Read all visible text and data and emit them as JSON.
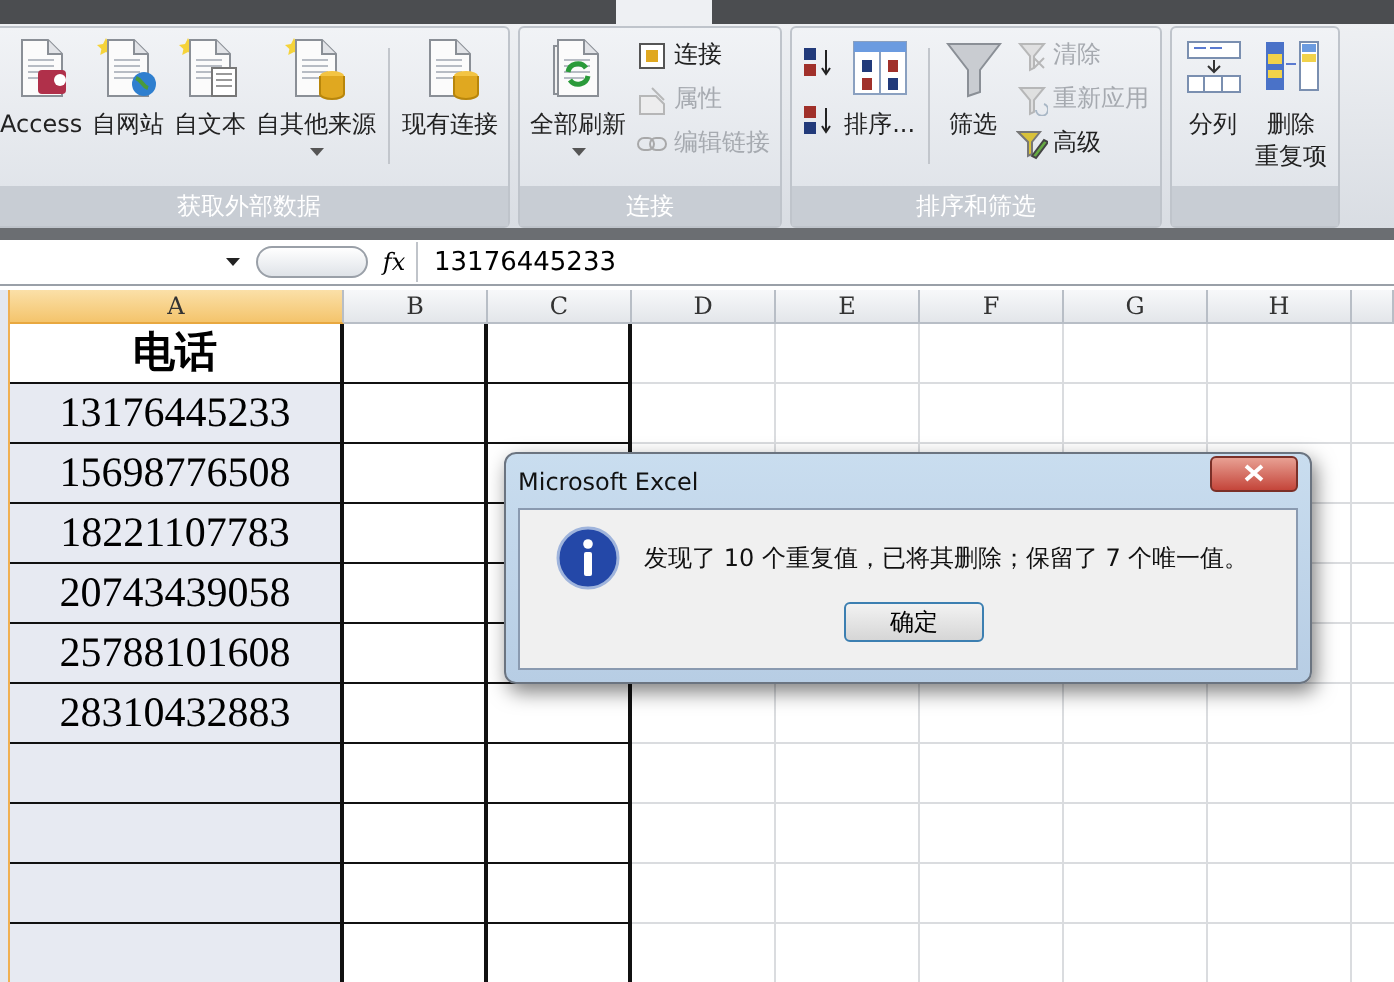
{
  "ribbon": {
    "groups": [
      {
        "label": "获取外部数据",
        "items": [
          {
            "kind": "large",
            "label": "Access",
            "dropdown": false
          },
          {
            "kind": "large",
            "label": "自网站",
            "dropdown": false
          },
          {
            "kind": "large",
            "label": "自文本",
            "dropdown": false
          },
          {
            "kind": "large",
            "label": "自其他来源",
            "dropdown": true
          },
          {
            "kind": "separator"
          },
          {
            "kind": "large",
            "label": "现有连接",
            "dropdown": false
          }
        ]
      },
      {
        "label": "连接",
        "items": [
          {
            "kind": "large",
            "label": "全部刷新",
            "dropdown": true
          },
          {
            "kind": "stack",
            "buttons": [
              {
                "label": "连接",
                "disabled": false
              },
              {
                "label": "属性",
                "disabled": true
              },
              {
                "label": "编辑链接",
                "disabled": true
              }
            ]
          }
        ]
      },
      {
        "label": "排序和筛选",
        "items": [
          {
            "kind": "stack",
            "buttons": [
              {
                "disabled": false
              },
              {
                "disabled": false
              }
            ]
          },
          {
            "kind": "large",
            "label": "排序...",
            "dropdown": false
          },
          {
            "kind": "separator"
          },
          {
            "kind": "large",
            "label": "筛选",
            "dropdown": false
          },
          {
            "kind": "stack",
            "buttons": [
              {
                "label": "清除",
                "disabled": true
              },
              {
                "label": "重新应用",
                "disabled": true
              },
              {
                "label": "高级",
                "disabled": false
              }
            ]
          }
        ]
      },
      {
        "items": [
          {
            "kind": "large",
            "label": "分列",
            "dropdown": false
          },
          {
            "kind": "large",
            "label_lines": [
              "删除",
              "重复项"
            ],
            "dropdown": false
          }
        ]
      }
    ]
  },
  "formula_bar": {
    "value": "13176445233",
    "fx": "fx"
  },
  "sheet": {
    "columns": [
      {
        "label": "A",
        "selected": true
      },
      {
        "label": "B",
        "selected": false
      },
      {
        "label": "C",
        "selected": false
      },
      {
        "label": "D",
        "selected": false
      },
      {
        "label": "E",
        "selected": false
      },
      {
        "label": "F",
        "selected": false
      },
      {
        "label": "G",
        "selected": false
      },
      {
        "label": "H",
        "selected": false
      }
    ],
    "rows": [
      {
        "a": "电话",
        "selected": false
      },
      {
        "a": "13176445233",
        "selected": true
      },
      {
        "a": "15698776508",
        "selected": true
      },
      {
        "a": "18221107783",
        "selected": true
      },
      {
        "a": "20743439058",
        "selected": true
      },
      {
        "a": "25788101608",
        "selected": true
      },
      {
        "a": "28310432883",
        "selected": true
      },
      {
        "selected": true
      },
      {
        "selected": true
      },
      {
        "selected": true
      },
      {
        "selected": true
      }
    ]
  },
  "dialog": {
    "title": "Microsoft Excel",
    "message": "发现了 10 个重复值，已将其删除；保留了 7 个唯一值。",
    "button": "确定"
  }
}
